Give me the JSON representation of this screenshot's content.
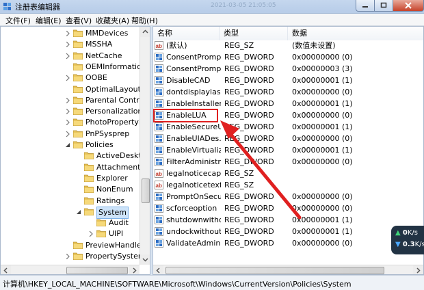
{
  "window": {
    "title": "注册表编辑器",
    "faded_overlay_text": "2021-03-05 21:05:05"
  },
  "menu": [
    "文件(F)",
    "编辑(E)",
    "查看(V)",
    "收藏夹(A)",
    "帮助(H)"
  ],
  "tree": [
    {
      "label": "MMDevices",
      "expander": "collapsed"
    },
    {
      "label": "MSSHA",
      "expander": "collapsed"
    },
    {
      "label": "NetCache",
      "expander": "collapsed"
    },
    {
      "label": "OEMInformatio",
      "expander": "none"
    },
    {
      "label": "OOBE",
      "expander": "collapsed"
    },
    {
      "label": "OptimalLayout",
      "expander": "none"
    },
    {
      "label": "Parental Contro",
      "expander": "collapsed"
    },
    {
      "label": "Personalization",
      "expander": "collapsed"
    },
    {
      "label": "PhotoPropertyH",
      "expander": "collapsed"
    },
    {
      "label": "PnPSysprep",
      "expander": "collapsed"
    },
    {
      "label": "Policies",
      "expander": "expanded"
    },
    {
      "label": "ActiveDeskt",
      "expander": "none"
    },
    {
      "label": "Attachments",
      "expander": "none"
    },
    {
      "label": "Explorer",
      "expander": "none"
    },
    {
      "label": "NonEnum",
      "expander": "none"
    },
    {
      "label": "Ratings",
      "expander": "none"
    },
    {
      "label": "System",
      "expander": "expanded"
    },
    {
      "label": "Audit",
      "expander": "none"
    },
    {
      "label": "UIPI",
      "expander": "collapsed"
    },
    {
      "label": "PreviewHandler",
      "expander": "none"
    },
    {
      "label": "PropertySysten",
      "expander": "collapsed"
    }
  ],
  "list_headers": {
    "name": "名称",
    "type": "类型",
    "data": "数据"
  },
  "values": [
    {
      "name": "(默认)",
      "type": "REG_SZ",
      "data": "(数值未设置)",
      "icon": "string-value-icon"
    },
    {
      "name": "ConsentPromp...",
      "type": "REG_DWORD",
      "data": "0x00000000 (0)",
      "icon": "dword-value-icon"
    },
    {
      "name": "ConsentPromp...",
      "type": "REG_DWORD",
      "data": "0x00000003 (3)",
      "icon": "dword-value-icon"
    },
    {
      "name": "DisableCAD",
      "type": "REG_DWORD",
      "data": "0x00000001 (1)",
      "icon": "dword-value-icon"
    },
    {
      "name": "dontdisplaylas...",
      "type": "REG_DWORD",
      "data": "0x00000000 (0)",
      "icon": "dword-value-icon"
    },
    {
      "name": "EnableInstaller...",
      "type": "REG_DWORD",
      "data": "0x00000001 (1)",
      "icon": "dword-value-icon"
    },
    {
      "name": "EnableLUA",
      "type": "REG_DWORD",
      "data": "0x00000000 (0)",
      "icon": "dword-value-icon"
    },
    {
      "name": "EnableSecureU...",
      "type": "REG_DWORD",
      "data": "0x00000001 (1)",
      "icon": "dword-value-icon"
    },
    {
      "name": "EnableUIADes...",
      "type": "REG_DWORD",
      "data": "0x00000000 (0)",
      "icon": "dword-value-icon"
    },
    {
      "name": "EnableVirtualiz...",
      "type": "REG_DWORD",
      "data": "0x00000001 (1)",
      "icon": "dword-value-icon"
    },
    {
      "name": "FilterAdministr...",
      "type": "REG_DWORD",
      "data": "0x00000000 (0)",
      "icon": "dword-value-icon"
    },
    {
      "name": "legalnoticecap...",
      "type": "REG_SZ",
      "data": "",
      "icon": "string-value-icon"
    },
    {
      "name": "legalnoticetext",
      "type": "REG_SZ",
      "data": "",
      "icon": "string-value-icon"
    },
    {
      "name": "PromptOnSecu...",
      "type": "REG_DWORD",
      "data": "0x00000000 (0)",
      "icon": "dword-value-icon"
    },
    {
      "name": "scforceoption",
      "type": "REG_DWORD",
      "data": "0x00000000 (0)",
      "icon": "dword-value-icon"
    },
    {
      "name": "shutdownwitho...",
      "type": "REG_DWORD",
      "data": "0x00000001 (1)",
      "icon": "dword-value-icon"
    },
    {
      "name": "undockwithout...",
      "type": "REG_DWORD",
      "data": "0x00000001 (1)",
      "icon": "dword-value-icon"
    },
    {
      "name": "ValidateAdmin...",
      "type": "REG_DWORD",
      "data": "0x00000000 (0)",
      "icon": "dword-value-icon"
    }
  ],
  "highlighted_value": "EnableLUA",
  "status_path": "计算机\\HKEY_LOCAL_MACHINE\\SOFTWARE\\Microsoft\\Windows\\CurrentVersion\\Policies\\System",
  "net_widget": {
    "up_value": "0",
    "up_unit": "K/s",
    "down_value": "0.3",
    "down_unit": "K/s"
  },
  "colors": {
    "annotation": "#e02020",
    "selection": "#cde3f9"
  }
}
